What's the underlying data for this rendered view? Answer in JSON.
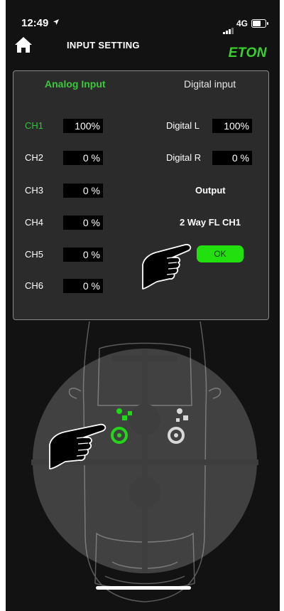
{
  "status_bar": {
    "time": "12:49",
    "location_arrow": "location-arrow-icon",
    "network": "4G",
    "battery_level": 0.7
  },
  "header": {
    "title": "INPUT SETTING",
    "logo": "ETON",
    "home_icon": "home-icon"
  },
  "tabs": {
    "analog": "Analog Input",
    "digital": "Digital input",
    "active": "analog"
  },
  "analog_channels": [
    {
      "label": "CH1",
      "value": "100%"
    },
    {
      "label": "CH2",
      "value": "0 %"
    },
    {
      "label": "CH3",
      "value": "0 %"
    },
    {
      "label": "CH4",
      "value": "0 %"
    },
    {
      "label": "CH5",
      "value": "0 %"
    },
    {
      "label": "CH6",
      "value": "0 %"
    }
  ],
  "digital_channels": [
    {
      "label": "Digital L",
      "value": "100%"
    },
    {
      "label": "Digital R",
      "value": "0 %"
    }
  ],
  "output": {
    "heading": "Output",
    "value": "2 Way FL CH1"
  },
  "ok_label": "OK",
  "colors": {
    "accent_green": "#22e00e",
    "active_label_green": "#2ec73a",
    "panel_bg": "#2b2b2b",
    "app_bg": "#121212",
    "logo_green": "#39d12c"
  }
}
